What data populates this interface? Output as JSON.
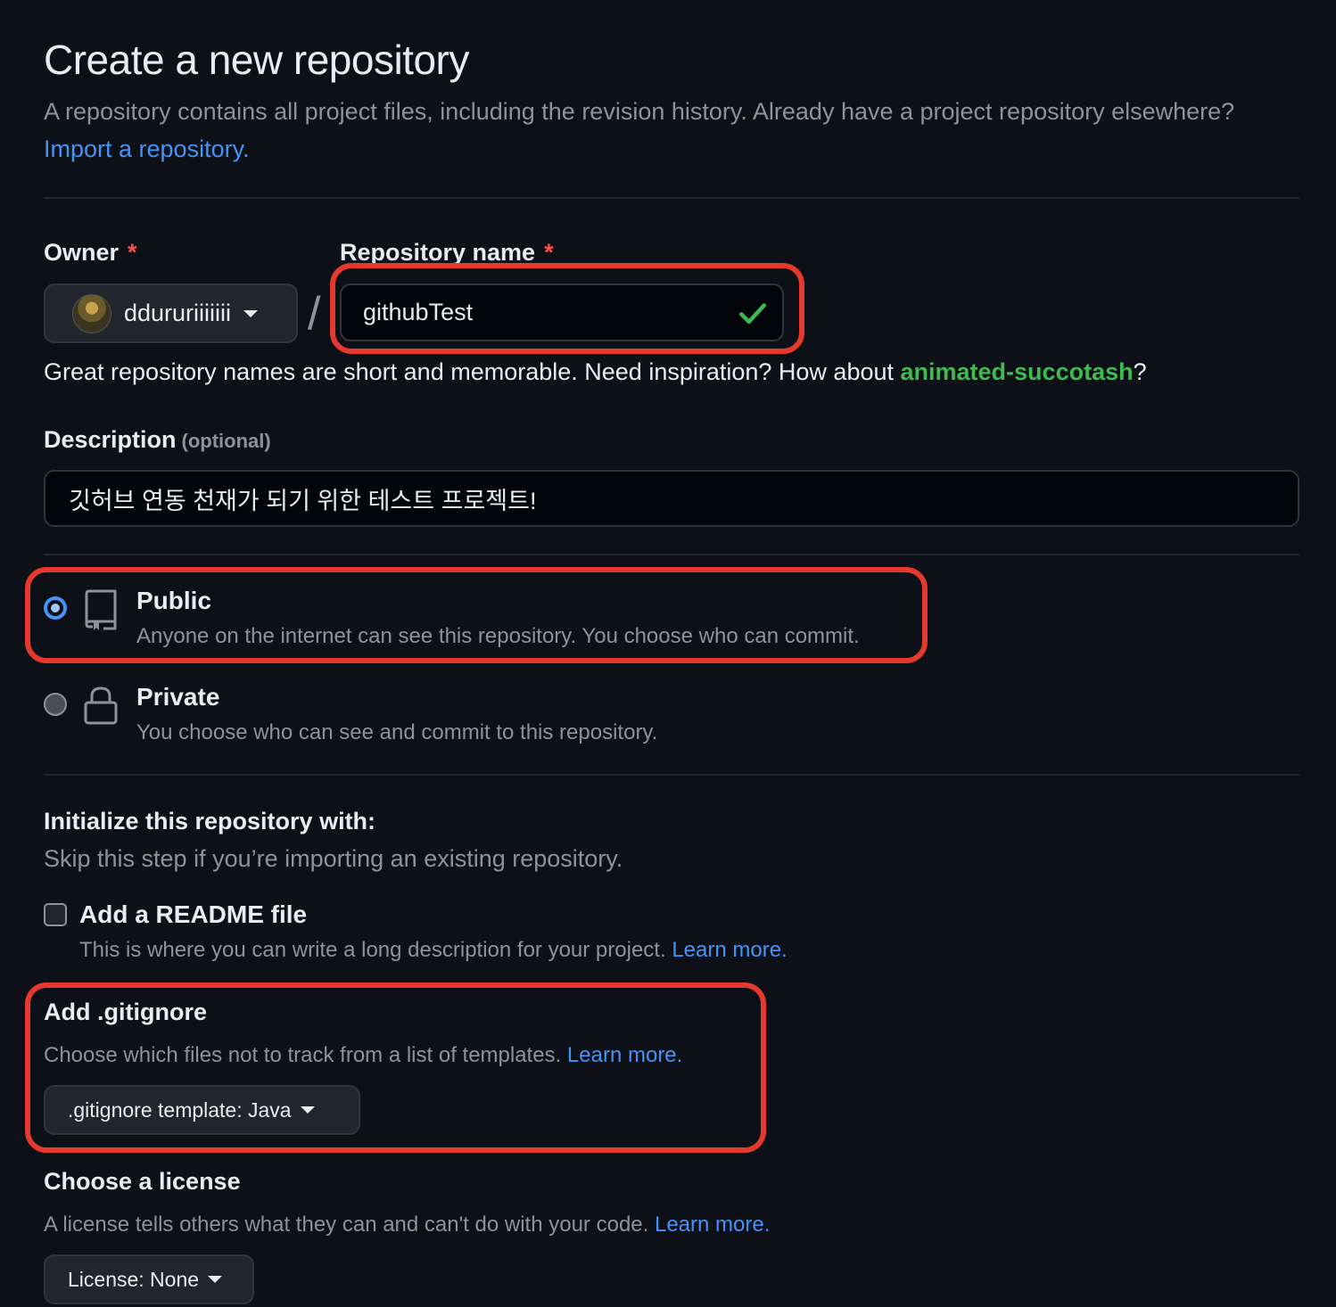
{
  "header": {
    "title": "Create a new repository",
    "subtitle": "A repository contains all project files, including the revision history. Already have a project repository elsewhere?",
    "import_link": "Import a repository."
  },
  "owner": {
    "label": "Owner",
    "required_mark": "*",
    "value": "ddururiiiiiii"
  },
  "repo_name": {
    "label": "Repository name",
    "required_mark": "*",
    "value": "githubTest",
    "separator": "/"
  },
  "hint": {
    "text": "Great repository names are short and memorable. Need inspiration? How about",
    "suggestion": "animated-succotash",
    "suffix": "?"
  },
  "description": {
    "label": "Description",
    "optional": "(optional)",
    "value": "깃허브 연동 천재가 되기 위한 테스트 프로젝트!"
  },
  "visibility": {
    "public": {
      "title": "Public",
      "desc": "Anyone on the internet can see this repository. You choose who can commit.",
      "selected": true
    },
    "private": {
      "title": "Private",
      "desc": "You choose who can see and commit to this repository.",
      "selected": false
    }
  },
  "initialize": {
    "title": "Initialize this repository with:",
    "desc": "Skip this step if you’re importing an existing repository.",
    "readme": {
      "label": "Add a README file",
      "desc": "This is where you can write a long description for your project.",
      "link": "Learn more.",
      "checked": false
    }
  },
  "gitignore": {
    "title": "Add .gitignore",
    "desc": "Choose which files not to track from a list of templates.",
    "link": "Learn more.",
    "select_label": ".gitignore template: Java"
  },
  "license": {
    "title": "Choose a license",
    "desc": "A license tells others what they can and can't do with your code.",
    "link": "Learn more.",
    "select_label": "License: None"
  },
  "colors": {
    "background": "#0d1117",
    "accent_link": "#4493f8",
    "success": "#3fb950",
    "highlight": "#e5392d",
    "required": "#f85149"
  },
  "icons": {
    "owner_dropdown": "chevron-down-icon",
    "valid": "check-icon",
    "public": "repo-icon",
    "private": "lock-icon"
  }
}
